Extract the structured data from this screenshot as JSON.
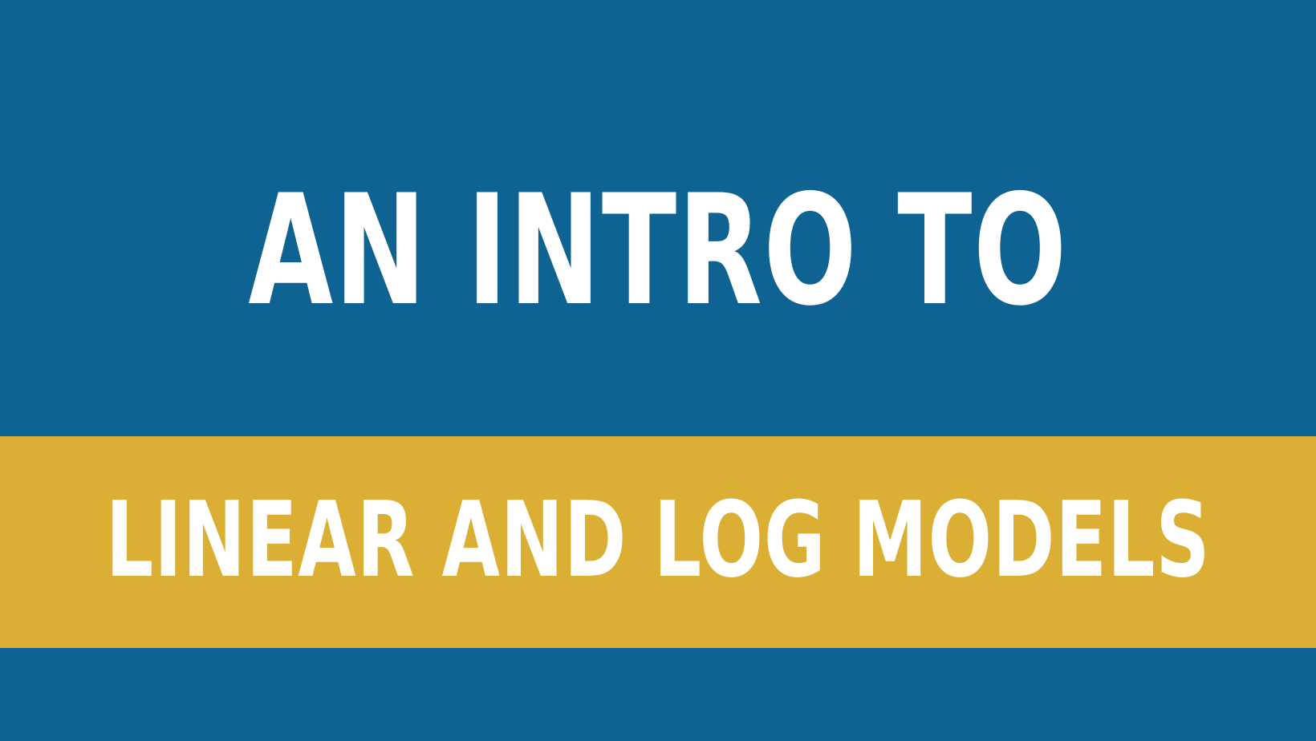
{
  "slide": {
    "line1": "AN INTRO TO",
    "line2": "LINEAR AND LOG MODELS"
  },
  "colors": {
    "background": "#0e6392",
    "band": "#dbaf33",
    "text": "#ffffff"
  }
}
